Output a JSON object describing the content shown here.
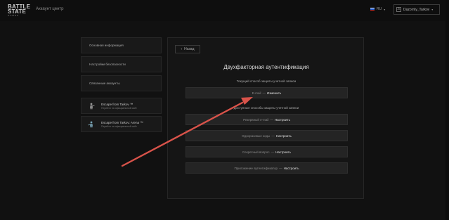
{
  "header": {
    "logo": {
      "line1": "BATTLE",
      "line2": "STATE",
      "line3": "GAMES"
    },
    "title": "Аккаунт центр",
    "language": {
      "code": "RU",
      "flag_colors": [
        "#ffffff",
        "#1c57c9",
        "#d62b2b"
      ]
    },
    "user": {
      "name": "Dazornly_Tarkov"
    }
  },
  "sidebar": {
    "items": [
      {
        "label": "Основная информация"
      },
      {
        "label": "Настройки безопасности"
      },
      {
        "label": "Связанные аккаунты"
      }
    ],
    "games": [
      {
        "title": "Escape from Tarkov ™",
        "subtitle": "Перейти на официальный сайт",
        "icon": "soldier-icon"
      },
      {
        "title": "Escape from Tarkov: Arena ™",
        "subtitle": "Перейти на официальный сайт",
        "icon": "arena-soldier-icon"
      }
    ]
  },
  "main": {
    "back_label": "Назад",
    "heading": "Двухфакторная аутентификация",
    "current_label": "Текущий способ защиты учетной записи",
    "current_method": {
      "name": "E-mail",
      "sep": "—",
      "action": "Изменить"
    },
    "available_label": "Доступные способы защиты учетной записи",
    "available_methods": [
      {
        "name": "Резервный e-mail",
        "sep": "—",
        "action": "Настроить"
      },
      {
        "name": "Одноразовые коды",
        "sep": "—",
        "action": "Настроить"
      },
      {
        "name": "Секретный вопрос",
        "sep": "—",
        "action": "Настроить"
      },
      {
        "name": "Приложение аутентификатор",
        "sep": "—",
        "action": "Настроить"
      }
    ]
  },
  "annotation": {
    "arrow_color": "#d9534a"
  }
}
